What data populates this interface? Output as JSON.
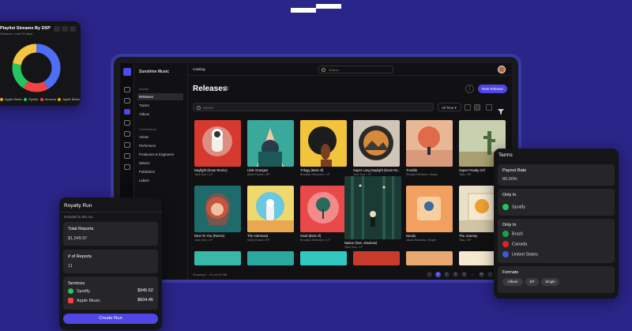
{
  "app": {
    "org_name": "Sunshine Music",
    "breadcrumb": "Catalog",
    "search_placeholder": "Search",
    "page_title": "Releases",
    "new_release": "New Release",
    "list_search_placeholder": "Search",
    "time_filter": "All Time",
    "footer": "Showing 1 - 24 out of 768",
    "pages": [
      "1",
      "2",
      "3",
      "4",
      "...",
      "32"
    ]
  },
  "sidebar": {
    "assets_label": "Assets",
    "assets": [
      "Releases",
      "Tracks",
      "Videos"
    ],
    "contributors_label": "Contributors",
    "contributors": [
      "Artists",
      "Performers",
      "Producers & Engineers",
      "Writers",
      "Publishers",
      "Labels"
    ]
  },
  "releases": [
    {
      "title": "Daylight (Evan Remix)",
      "sub": "Jane Doe • LP"
    },
    {
      "title": "Little Oranges",
      "sub": "Albert Flores • EP"
    },
    {
      "title": "Trilogy (Best of)",
      "sub": "Brooklyn Simmons • LP"
    },
    {
      "title": "Super Long Daylight (Evan Re...",
      "sub": "Jane Doe • LP"
    },
    {
      "title": "Trouble",
      "sub": "Ronald Richards • Single"
    },
    {
      "title": "Super Freaky Girl",
      "sub": "Tallo • EP"
    },
    {
      "title": "Next To You (Remix)",
      "sub": "Jane Doe • LP"
    },
    {
      "title": "The Astronaut",
      "sub": "Kathy Evans • EP"
    },
    {
      "title": "Snail (Best of)",
      "sub": "Brooklyn Simmons • LP"
    },
    {
      "title": "Nation (feat. Absolute)",
      "sub": "Jane Doe • LP"
    },
    {
      "title": "Noodo",
      "sub": "Jacob Richards • Single"
    },
    {
      "title": "The Journey",
      "sub": "Tallo • EP"
    }
  ],
  "playlist": {
    "title": "Playlist Streams By DSP",
    "subtitle": "Streams • Last 28 days",
    "legend": [
      {
        "name": "Apple Music",
        "color": "#f0a030"
      },
      {
        "name": "Spotify",
        "color": "#22c55e"
      },
      {
        "name": "Amazon",
        "color": "#ef4444"
      },
      {
        "name": "Apple Music",
        "color": "#f59e0b"
      }
    ],
    "slices": [
      {
        "color": "#4f6df5",
        "value": 0.42
      },
      {
        "color": "#ef4444",
        "value": 0.17
      },
      {
        "color": "#22c55e",
        "value": 0.19
      },
      {
        "color": "#f5c542",
        "value": 0.22
      }
    ]
  },
  "royalty": {
    "title": "Royalty Run",
    "included": "Included in this run",
    "total_reports_label": "Total Reports",
    "total_reports_value": "$1,549.97",
    "num_reports_label": "# of Reports",
    "num_reports_value": "11",
    "services_label": "Services",
    "services": [
      {
        "name": "Spotify",
        "amount": "$945.52",
        "color": "#22c55e"
      },
      {
        "name": "Apple Music",
        "amount": "$604.45",
        "color": "#ef4444"
      }
    ],
    "create_button": "Create Run"
  },
  "terms": {
    "title": "Terms",
    "payout_label": "Payout Rate",
    "payout_value": "80.00%",
    "only_in_dsp_label": "Only In",
    "only_in_dsp_value": "Spotify",
    "only_in_region_label": "Only In",
    "regions": [
      "Brazil",
      "Canada",
      "United States"
    ],
    "formats_label": "Formats",
    "formats": [
      "Album",
      "EP",
      "Single"
    ]
  },
  "colors": {
    "background": "#2a2588",
    "accent": "#4f46e5"
  }
}
